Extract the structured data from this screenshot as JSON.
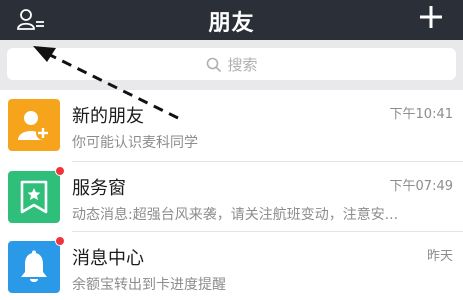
{
  "header": {
    "title": "朋友",
    "left_icon": "contacts-icon",
    "right_icon": "plus-icon"
  },
  "search": {
    "placeholder": "搜索",
    "icon": "search-icon"
  },
  "list": [
    {
      "name": "新的朋友",
      "message": "你可能认识麦科同学",
      "time": "下午10:41",
      "icon": "add-friend-icon",
      "color": "#f7a41d",
      "badge": false
    },
    {
      "name": "服务窗",
      "message": "动态消息:超强台风来袭，请关注航班变动，注意安...",
      "time": "下午07:49",
      "icon": "service-window-icon",
      "color": "#2fbf7a",
      "badge": true
    },
    {
      "name": "消息中心",
      "message": "余额宝转出到卡进度提醒",
      "time": "昨天",
      "icon": "bell-icon",
      "color": "#2a9ae8",
      "badge": true
    }
  ],
  "colors": {
    "header_bg": "#2b3038",
    "badge": "#f2323c",
    "annotation_arrow": "#111111"
  }
}
